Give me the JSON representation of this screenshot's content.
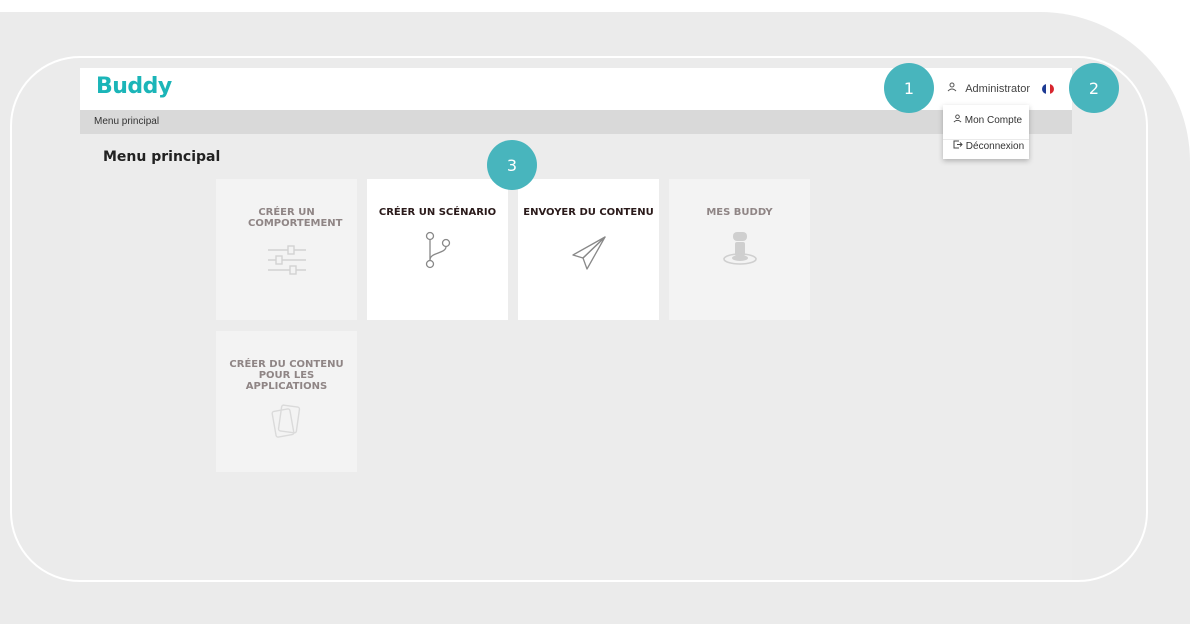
{
  "app": {
    "logo": "Buddy"
  },
  "header": {
    "user_label": "Administrator",
    "user_icon": "user-icon",
    "flag": "fr-flag-icon",
    "flag_colors": [
      "#1d3a93",
      "#ffffff",
      "#d8262f"
    ]
  },
  "breadcrumb": {
    "label": "Menu principal"
  },
  "page": {
    "title": "Menu principal"
  },
  "tiles": [
    {
      "label": "CRÉER UN COMPORTEMENT",
      "icon": "sliders-icon",
      "state": "disabled"
    },
    {
      "label": "CRÉER UN SCÉNARIO",
      "icon": "branch-icon",
      "state": "enabled"
    },
    {
      "label": "ENVOYER DU CONTENU",
      "icon": "paper-plane-icon",
      "state": "enabled"
    },
    {
      "label": "MES BUDDY",
      "icon": "robot-icon",
      "state": "disabled"
    },
    {
      "label": "CRÉER DU CONTENU POUR LES APPLICATIONS",
      "icon": "cards-icon",
      "state": "disabled"
    }
  ],
  "dropdown": {
    "items": [
      {
        "label": "Mon Compte",
        "icon": "user-icon"
      },
      {
        "label": "Déconnexion",
        "icon": "logout-icon"
      }
    ]
  },
  "callouts": [
    "1",
    "2",
    "3"
  ],
  "colors": {
    "accent": "#1bb5b8",
    "badge": "#48b5bd"
  }
}
